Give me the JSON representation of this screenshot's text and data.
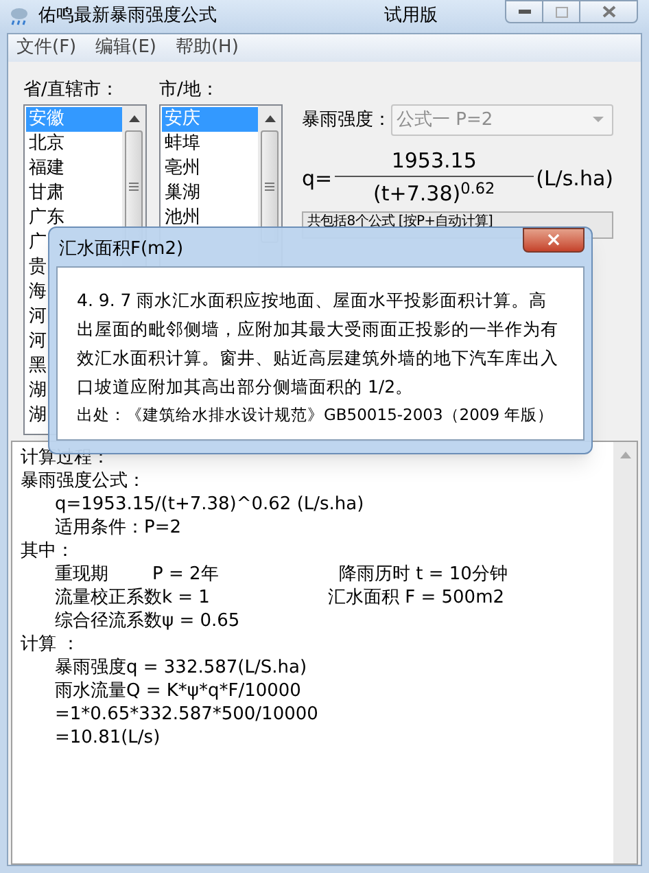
{
  "window": {
    "title": "佑鸣最新暴雨强度公式",
    "edition": "试用版"
  },
  "menu": [
    "文件(F)",
    "编辑(E)",
    "帮助(H)"
  ],
  "province_list": {
    "label": "省/直辖市：",
    "items": [
      {
        "text": "安徽",
        "selected": true
      },
      {
        "text": "北京",
        "selected": false
      },
      {
        "text": "福建",
        "selected": false
      },
      {
        "text": "甘肃",
        "selected": false
      },
      {
        "text": "广东",
        "selected": false
      },
      {
        "text": "广",
        "selected": false
      },
      {
        "text": "贵",
        "selected": false
      },
      {
        "text": "海",
        "selected": false
      },
      {
        "text": "河",
        "selected": false
      },
      {
        "text": "河",
        "selected": false
      },
      {
        "text": "黑",
        "selected": false
      },
      {
        "text": "湖",
        "selected": false
      },
      {
        "text": "湖",
        "selected": false
      }
    ]
  },
  "city_list": {
    "label": "市/地：",
    "items": [
      {
        "text": "安庆",
        "selected": true
      },
      {
        "text": "蚌埠",
        "selected": false
      },
      {
        "text": "亳州",
        "selected": false
      },
      {
        "text": "巢湖",
        "selected": false
      },
      {
        "text": "池州",
        "selected": false
      }
    ]
  },
  "formula_select": {
    "label": "暴雨强度：",
    "value": "公式一 P=2",
    "disabled": true
  },
  "formula": {
    "lhs": "q=",
    "numerator": "1953.15",
    "denominator": "(t+7.38)$^{0.62}$",
    "unit": "(L/s.ha)"
  },
  "formula_button": "共包括8个公式 [按P+自动计算]",
  "dialog": {
    "title": "汇水面积F(m2)",
    "close": "×",
    "text": "4. 9. 7 雨水汇水面积应按地面、屋面水平投影面积计算。高出屋面的毗邻侧墙，应附加其最大受雨面正投影的一半作为有效汇水面积计算。窗井、贴近高层建筑外墙的地下汽车库出入口坡道应附加其高出部分侧墙面积的 1/2。",
    "source": "出处：《建筑给水排水设计规范》GB50015-2003（2009 年版）"
  },
  "calculation": [
    {
      "kind": "heading",
      "text": "计算过程："
    },
    {
      "kind": "heading",
      "text": "暴雨强度公式："
    },
    {
      "kind": "item",
      "text": "q=1953.15/(t+7.38)^0.62 (L/s.ha)"
    },
    {
      "kind": "item",
      "text": "适用条件：P=2"
    },
    {
      "kind": "heading",
      "text": "其中："
    },
    {
      "kind": "triple",
      "left": "重现期",
      "middle": "P = 2年",
      "right": "降雨历时 t = 10分钟"
    },
    {
      "kind": "pair",
      "left": "流量校正系数k = 1",
      "right": "汇水面积 F = 500m2"
    },
    {
      "kind": "item",
      "text": "综合径流系数ψ = 0.65"
    },
    {
      "kind": "heading",
      "text": "计算 ："
    },
    {
      "kind": "item",
      "text": "暴雨强度q = 332.587(L/S.ha)"
    },
    {
      "kind": "item",
      "text": "雨水流量Q = K*ψ*q*F/10000"
    },
    {
      "kind": "item",
      "text": "=1*0.65*332.587*500/10000"
    },
    {
      "kind": "item",
      "text": "=10.81(L/s)"
    }
  ]
}
